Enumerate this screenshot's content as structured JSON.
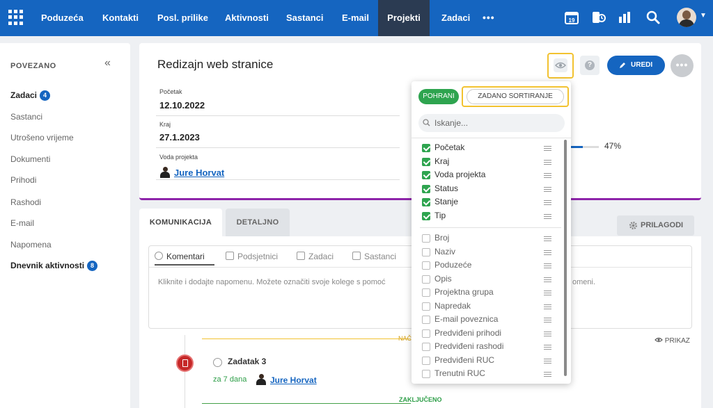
{
  "nav": {
    "items": [
      "Poduzeća",
      "Kontakti",
      "Posl. prilike",
      "Aktivnosti",
      "Sastanci",
      "E-mail",
      "Projekti",
      "Zadaci"
    ],
    "active": "Projekti",
    "more": "•••",
    "calendar_day": "19"
  },
  "sidebar": {
    "title": "POVEZANO",
    "collapse": "«",
    "items": [
      {
        "label": "Zadaci",
        "badge": "4"
      },
      {
        "label": "Sastanci"
      },
      {
        "label": "Utrošeno vrijeme"
      },
      {
        "label": "Dokumenti"
      },
      {
        "label": "Prihodi"
      },
      {
        "label": "Rashodi"
      },
      {
        "label": "E-mail"
      },
      {
        "label": "Napomena"
      },
      {
        "label": "Dnevnik aktivnosti",
        "badge": "8"
      }
    ]
  },
  "project": {
    "title": "Redizajn web stranice",
    "fields": [
      {
        "label": "Početak",
        "value": "12.10.2022"
      },
      {
        "label": "Kraj",
        "value": "27.1.2023"
      },
      {
        "label": "Voda projekta",
        "value": "Jure Horvat"
      }
    ],
    "progress_text": "47%",
    "progress": 0.47,
    "edit_label": "UREDI",
    "help_label": "?",
    "more_label": "•••"
  },
  "tabs": {
    "komunikacija": "KOMUNIKACIJA",
    "detaljno": "DETALJNO",
    "prilagodi": "PRILAGODI"
  },
  "comment": {
    "tabs": [
      "Komentari",
      "Podsjetnici",
      "Zadaci",
      "Sastanci"
    ],
    "placeholder_left": "Kliknite i dodajte napomenu. Možete označiti svoje kolege s pomoć",
    "placeholder_right": "omeni."
  },
  "timeline": {
    "prikaz": "PRIKAZ",
    "nac": "NAČ",
    "task_title": "Zadatak 3",
    "task_due": "za 7 dana",
    "task_person": "Jure Horvat",
    "done": "ZAKLJUČENO"
  },
  "dropdown": {
    "save": "POHRANI",
    "sort": "ZADANO SORTIRANJE",
    "search_placeholder": "Iskanje...",
    "checked": [
      "Početak",
      "Kraj",
      "Voda projekta",
      "Status",
      "Stanje",
      "Tip"
    ],
    "unchecked": [
      "Broj",
      "Naziv",
      "Poduzeće",
      "Opis",
      "Projektna grupa",
      "Napredak",
      "E-mail poveznica",
      "Predviđeni prihodi",
      "Predviđeni rashodi",
      "Predviđeni RUC",
      "Trenutni RUC"
    ]
  },
  "colors": {
    "topbar": "#1565c0",
    "accent_green": "#2ea44f",
    "highlight": "#f2c230",
    "card_border": "#8e24aa"
  }
}
